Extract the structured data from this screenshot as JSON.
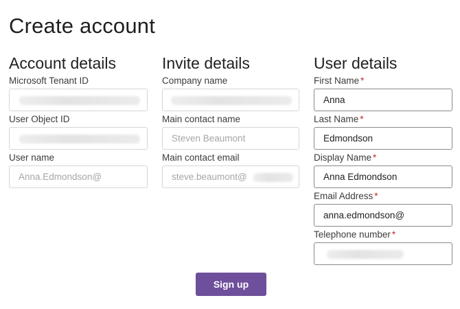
{
  "page": {
    "title": "Create account"
  },
  "account": {
    "heading": "Account details",
    "tenant_label": "Microsoft Tenant ID",
    "object_label": "User Object ID",
    "username_label": "User name",
    "username_value": "Anna.Edmondson@"
  },
  "invite": {
    "heading": "Invite details",
    "company_label": "Company name",
    "contact_name_label": "Main contact name",
    "contact_name_value": "Steven Beaumont",
    "contact_email_label": "Main contact email",
    "contact_email_value": "steve.beaumont@"
  },
  "user": {
    "heading": "User details",
    "required_mark": "*",
    "first_label": "First Name",
    "first_value": "Anna",
    "last_label": "Last Name",
    "last_value": "Edmondson",
    "display_label": "Display Name",
    "display_value": "Anna Edmondson",
    "email_label": "Email Address",
    "email_value": "anna.edmondson@",
    "phone_label": "Telephone number"
  },
  "actions": {
    "signup_label": "Sign up"
  },
  "colors": {
    "accent": "#6e4f9b",
    "required": "#c4262e"
  }
}
